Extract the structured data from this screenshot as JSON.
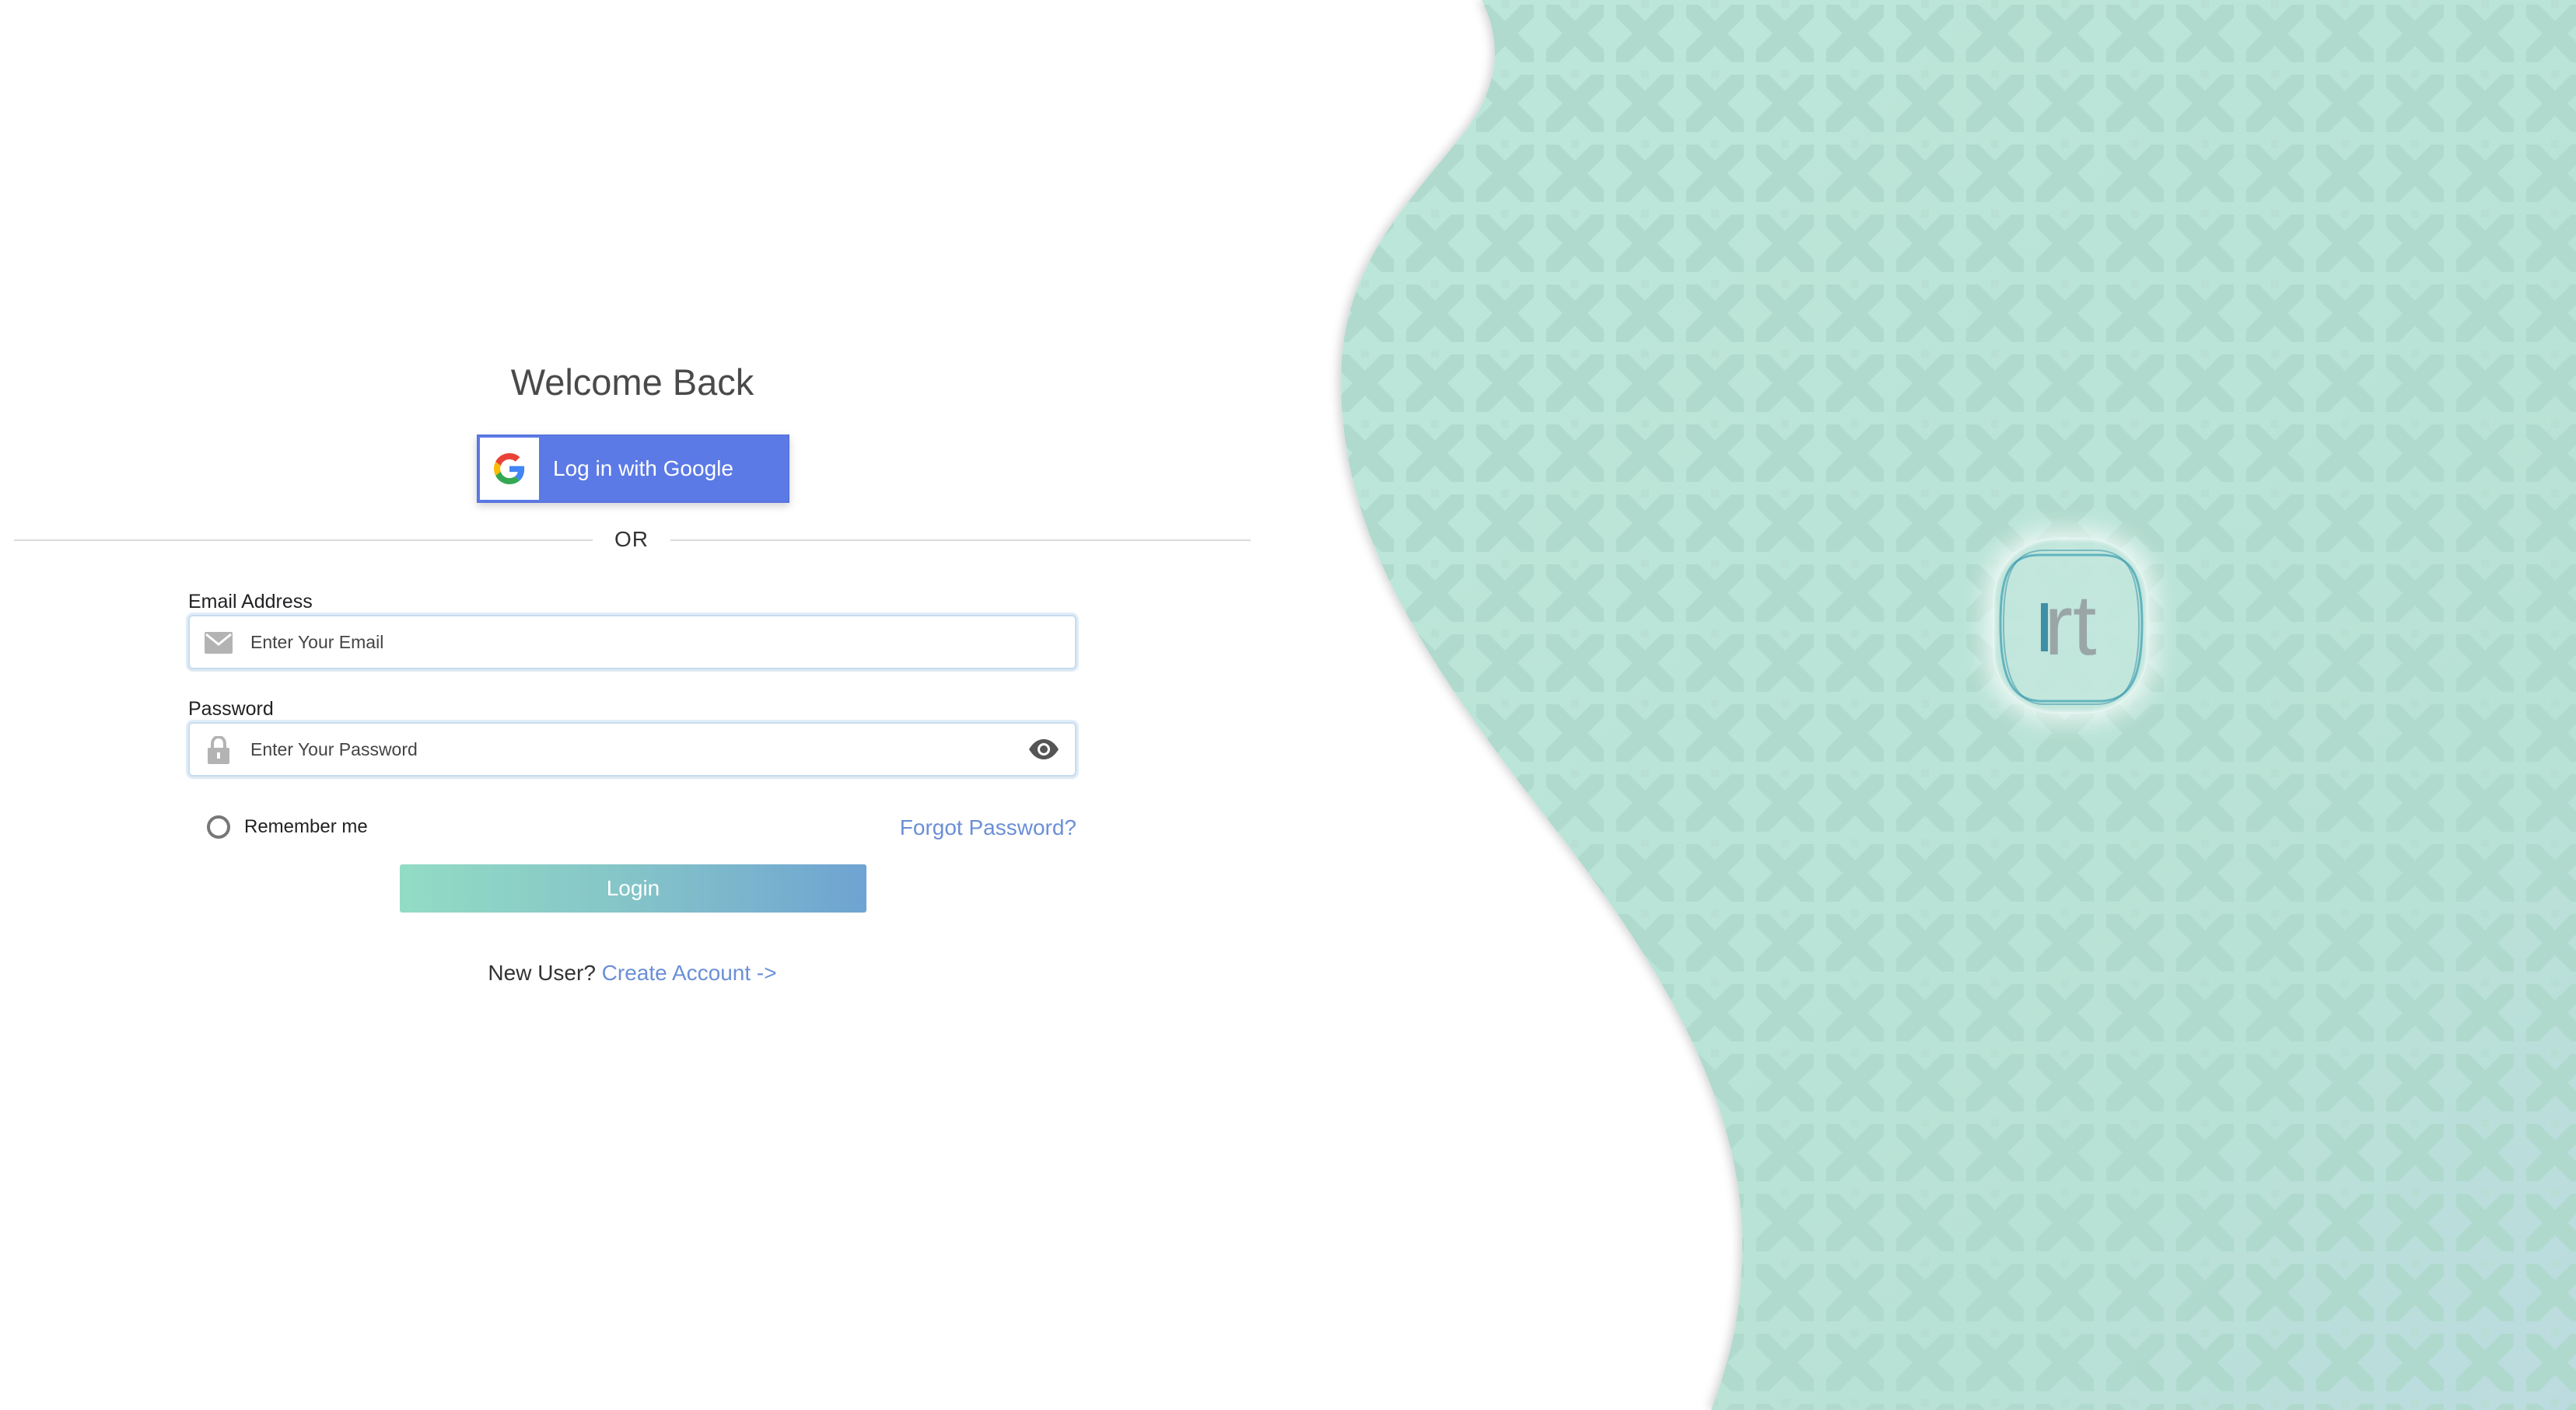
{
  "login": {
    "title": "Welcome Back",
    "google_button_label": "Log in with Google",
    "divider_text": "OR",
    "email": {
      "label": "Email Address",
      "placeholder": "Enter Your Email",
      "value": ""
    },
    "password": {
      "label": "Password",
      "placeholder": "Enter Your Password",
      "value": ""
    },
    "remember_label": "Remember me",
    "remember_checked": false,
    "forgot_link": "Forgot Password?",
    "login_button": "Login",
    "new_user_text": "New User?",
    "create_account_link": "Create Account ->"
  },
  "brand": {
    "logo_text": "rt"
  },
  "icons": {
    "google": "google-icon",
    "email": "mail-icon",
    "password": "lock-icon",
    "show_password": "eye-icon"
  },
  "colors": {
    "google_button": "#5c7ae6",
    "link": "#6b8fd6",
    "login_gradient_start": "#93dcc4",
    "login_gradient_end": "#6fa3d2",
    "panel_background": "#bfe6da",
    "panel_pattern": "#a9d5c8"
  }
}
